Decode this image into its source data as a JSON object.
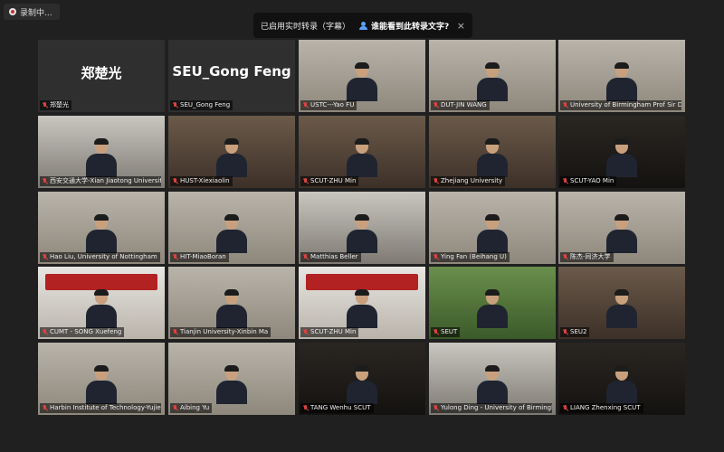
{
  "recording": {
    "label": "录制中..."
  },
  "captions": {
    "status": "已启用实时转录（字幕）",
    "prompt": "谁能看到此转录文字?",
    "close": "×"
  },
  "tiles": [
    {
      "label": "郑楚光",
      "big": "郑楚光",
      "scene": "blank"
    },
    {
      "label": "SEU_Gong Feng",
      "big": "SEU_Gong Feng",
      "scene": "blank"
    },
    {
      "label": "USTC---Yao FU",
      "scene": "office"
    },
    {
      "label": "DUT-JIN WANG",
      "scene": "office"
    },
    {
      "label": "University of Birmingham Prof Sir David",
      "scene": "office",
      "active": true
    },
    {
      "label": "西安交通大学-Xian Jiaotong University",
      "scene": "room"
    },
    {
      "label": "HUST-Xiexiaolin",
      "scene": "hall"
    },
    {
      "label": "SCUT-ZHU Min",
      "scene": "hall"
    },
    {
      "label": "Zhejiang University",
      "scene": "hall"
    },
    {
      "label": "SCUT-YAO Min",
      "scene": "dark"
    },
    {
      "label": "Hao Liu, University of Nottingham",
      "scene": "office"
    },
    {
      "label": "HIT-MiaoBoran",
      "scene": "office"
    },
    {
      "label": "Matthias Beller",
      "scene": "room"
    },
    {
      "label": "Ying Fan (Beihang U)",
      "scene": "office"
    },
    {
      "label": "陈杰-同济大学",
      "scene": "office"
    },
    {
      "label": "CUMT - SONG Xuefeng",
      "scene": "banner"
    },
    {
      "label": "Tianjin University-Xinbin Ma",
      "scene": "office"
    },
    {
      "label": "SCUT-ZHU Min",
      "scene": "banner"
    },
    {
      "label": "SEUT",
      "scene": "green"
    },
    {
      "label": "SEU2",
      "scene": "hall"
    },
    {
      "label": "Harbin Institute of Technology-Yujie",
      "scene": "office"
    },
    {
      "label": "Aibing Yu",
      "scene": "office"
    },
    {
      "label": "TANG Wenhu SCUT",
      "scene": "dark"
    },
    {
      "label": "Yulong Ding - University of Birmingham",
      "scene": "room"
    },
    {
      "label": "LIANG Zhenxing SCUT",
      "scene": "dark"
    }
  ],
  "colors": {
    "active_outline": "#d6d94a",
    "mic_muted": "#e04040",
    "banner_red": "#b22222"
  }
}
